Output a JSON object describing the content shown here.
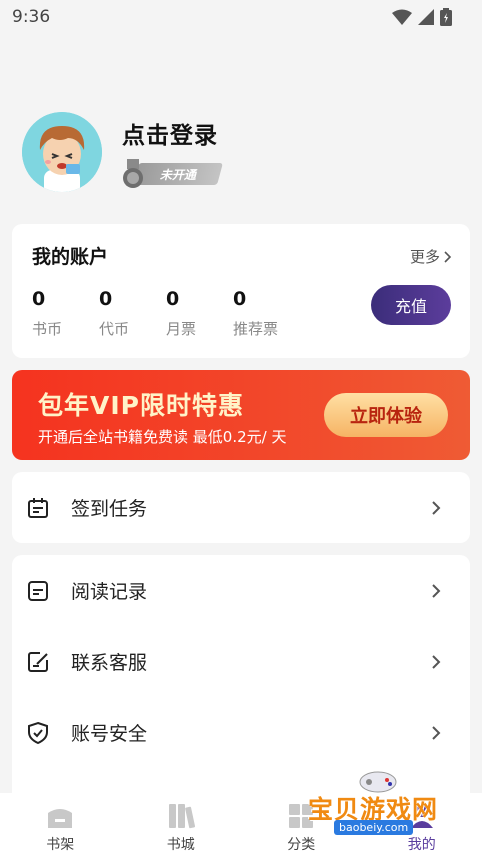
{
  "status_bar": {
    "time": "9:36"
  },
  "profile": {
    "login_text": "点击登录",
    "member_status": "未开通"
  },
  "account": {
    "title": "我的账户",
    "more": "更多",
    "stats": [
      {
        "value": "0",
        "label": "书币"
      },
      {
        "value": "0",
        "label": "代币"
      },
      {
        "value": "0",
        "label": "月票"
      },
      {
        "value": "0",
        "label": "推荐票"
      }
    ],
    "recharge": "充值"
  },
  "vip_banner": {
    "title": "包年VIP限时特惠",
    "subtitle": "开通后全站书籍免费读 最低0.2元/ 天",
    "button": "立即体验"
  },
  "menu": {
    "sign_in": "签到任务",
    "read_history": "阅读记录",
    "contact": "联系客服",
    "security": "账号安全"
  },
  "bottom_nav": [
    {
      "label": "书架",
      "icon": "bookshelf-icon"
    },
    {
      "label": "书城",
      "icon": "bookstore-icon"
    },
    {
      "label": "分类",
      "icon": "category-icon"
    },
    {
      "label": "我的",
      "icon": "profile-icon"
    }
  ],
  "watermark": {
    "text": "宝贝游戏网",
    "url": "baobeiy.com"
  },
  "colors": {
    "accent": "#4a348c",
    "banner": "#f23a22",
    "banner_button": "#fbcd86"
  }
}
